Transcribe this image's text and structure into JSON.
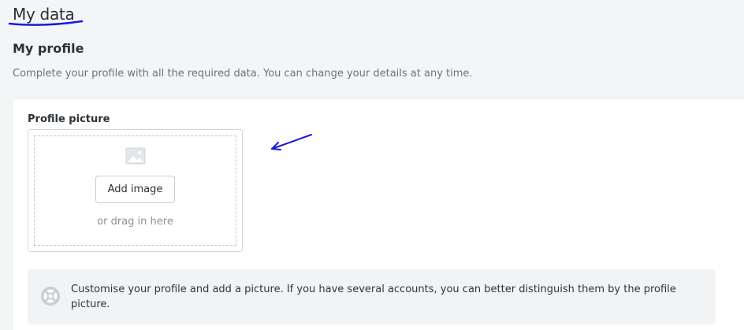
{
  "page": {
    "title": "My data"
  },
  "profile_section": {
    "title": "My profile",
    "description": "Complete your profile with all the required data. You can change your details at any time."
  },
  "profile_picture": {
    "label": "Profile picture",
    "add_button_label": "Add image",
    "drag_hint": "or drag in here",
    "placeholder_icon": "image-icon"
  },
  "info": {
    "icon": "lifebuoy-icon",
    "text": "Customise your profile and add a picture. If you have several accounts, you can better distinguish them by the profile picture."
  },
  "annotations": {
    "underline_color": "#1a1adb",
    "arrow_color": "#1a1adb"
  }
}
